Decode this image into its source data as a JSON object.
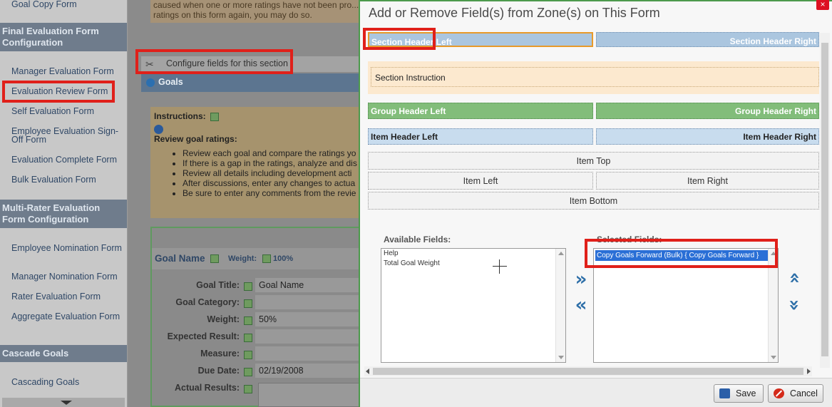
{
  "sidebar": {
    "top_link": "Goal Copy Form",
    "groups": [
      {
        "title": "Final Evaluation Form Configuration"
      },
      {
        "title": "Multi-Rater Evaluation Form Configuration"
      },
      {
        "title": "Cascade Goals"
      }
    ],
    "final_links": [
      "Manager Evaluation Form",
      "Evaluation Review Form",
      "Self Evaluation Form",
      "Employee Evaluation Sign-Off Form",
      "Evaluation Complete Form",
      "Bulk Evaluation Form"
    ],
    "multi_links": [
      "Employee Nomination Form",
      "Manager Nomination Form",
      "Rater Evaluation Form",
      "Aggregate Evaluation Form"
    ],
    "cascade_links": [
      "Cascading Goals"
    ]
  },
  "main": {
    "warning_text": "caused when one or more ratings have not been pro... ratings on this form again, you may do so.",
    "configure_link": "Configure fields for this section",
    "section_title": "Goals",
    "instructions_label": "Instructions:",
    "instructions_heading": "Review goal ratings:",
    "instructions_items": [
      "Review each goal and compare the ratings yo",
      "If there is a gap in the ratings, analyze and dis",
      "Review all details including development acti",
      "After discussions, enter any changes to actua",
      "Be sure to enter any comments from the revie"
    ],
    "goal_name_label": "Goal Name",
    "weight_label": "Weight:",
    "weight_value": "100%",
    "fields": [
      {
        "label": "Goal Title:",
        "value": "Goal Name"
      },
      {
        "label": "Goal Category:",
        "value": ""
      },
      {
        "label": "Weight:",
        "value": "50%"
      },
      {
        "label": "Expected Result:",
        "value": ""
      },
      {
        "label": "Measure:",
        "value": ""
      },
      {
        "label": "Due Date:",
        "value": "02/19/2008"
      },
      {
        "label": "Actual Results:",
        "value": ""
      }
    ]
  },
  "dialog": {
    "title": "Add or Remove Field(s) from Zone(s) on This Form",
    "close_label": "×",
    "zones": {
      "section_header_left": "Section Header Left",
      "section_header_right": "Section Header Right",
      "section_instruction": "Section Instruction",
      "group_header_left": "Group Header Left",
      "group_header_right": "Group Header Right",
      "item_header_left": "Item Header Left",
      "item_header_right": "Item Header Right",
      "item_top": "Item Top",
      "item_left": "Item Left",
      "item_right": "Item Right",
      "item_bottom": "Item Bottom"
    },
    "available_label": "Available Fields:",
    "available_fields": [
      "Help",
      "Total Goal Weight"
    ],
    "selected_label": "Selected Fields:",
    "selected_fields": [
      "Copy Goals Forward (Bulk) { Copy Goals Forward }"
    ],
    "save_label": "Save",
    "cancel_label": "Cancel"
  },
  "colors": {
    "highlight_red": "#e0201a",
    "dialog_border": "#4c9a4c",
    "selection_blue": "#2a6fd6",
    "arrow_blue": "#2e6fa8"
  }
}
